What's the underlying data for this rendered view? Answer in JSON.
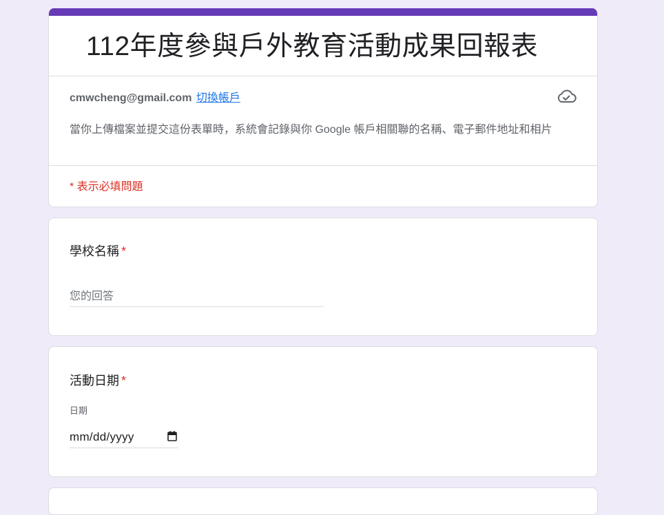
{
  "form": {
    "title": "112年度參與戶外教育活動成果回報表",
    "accent_color": "#673ab7",
    "background_color": "#f0ebf8"
  },
  "account": {
    "email": "cmwcheng@gmail.com",
    "switch_label": "切換帳戶",
    "status_icon": "cloud-check-icon"
  },
  "notice": "當你上傳檔案並提交這份表單時，系統會記錄與你 Google 帳戶相關聯的名稱、電子郵件地址和相片",
  "required_note": "* 表示必填問題",
  "questions": [
    {
      "title": "學校名稱",
      "required_mark": "*",
      "placeholder": "您的回答"
    },
    {
      "title": "活動日期",
      "required_mark": "*",
      "sub_label": "日期",
      "value": "mm/dd/yyyy",
      "icon": "calendar-icon"
    }
  ]
}
